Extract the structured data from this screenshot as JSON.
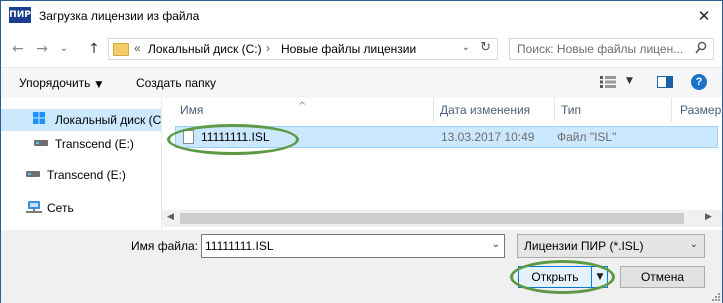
{
  "window": {
    "title": "Загрузка лицензии из файла",
    "app_icon_text": "ПИР",
    "close_glyph": "✕"
  },
  "nav": {
    "back_glyph": "←",
    "forward_glyph": "→",
    "recent_glyph": "⌄",
    "up_glyph": "↑",
    "address": {
      "prefix": "«",
      "segments": [
        "Локальный диск (C:)",
        "Новые файлы лицензии"
      ],
      "separator": "›"
    },
    "search_placeholder": "Поиск: Новые файлы лицен..."
  },
  "toolbar": {
    "organize_label": "Упорядочить",
    "new_folder_label": "Создать папку",
    "help_glyph": "?"
  },
  "sidebar": {
    "items": [
      {
        "label": "Локальный диск (C:)",
        "icon": "windows-drive-icon",
        "selected": true
      },
      {
        "label": "Transcend (E:)",
        "icon": "drive-icon",
        "selected": false
      },
      {
        "label": "Transcend (E:)",
        "icon": "drive-icon",
        "selected": false
      },
      {
        "label": "Сеть",
        "icon": "network-icon",
        "selected": false
      }
    ]
  },
  "file_list": {
    "columns": [
      "Имя",
      "Дата изменения",
      "Тип",
      "Размер"
    ],
    "rows": [
      {
        "name": "11111111.ISL",
        "date": "13.03.2017 10:49",
        "type": "Файл \"ISL\"",
        "selected": true
      }
    ]
  },
  "footer": {
    "filename_label": "Имя файла:",
    "filename_value": "11111111.ISL",
    "filter_value": "Лицензии ПИР (*.ISL)",
    "open_label": "Открыть",
    "cancel_label": "Отмена"
  },
  "colors": {
    "highlight_ellipse": "#5e9a46",
    "selection": "#cce8ff",
    "accent": "#0078d7"
  }
}
